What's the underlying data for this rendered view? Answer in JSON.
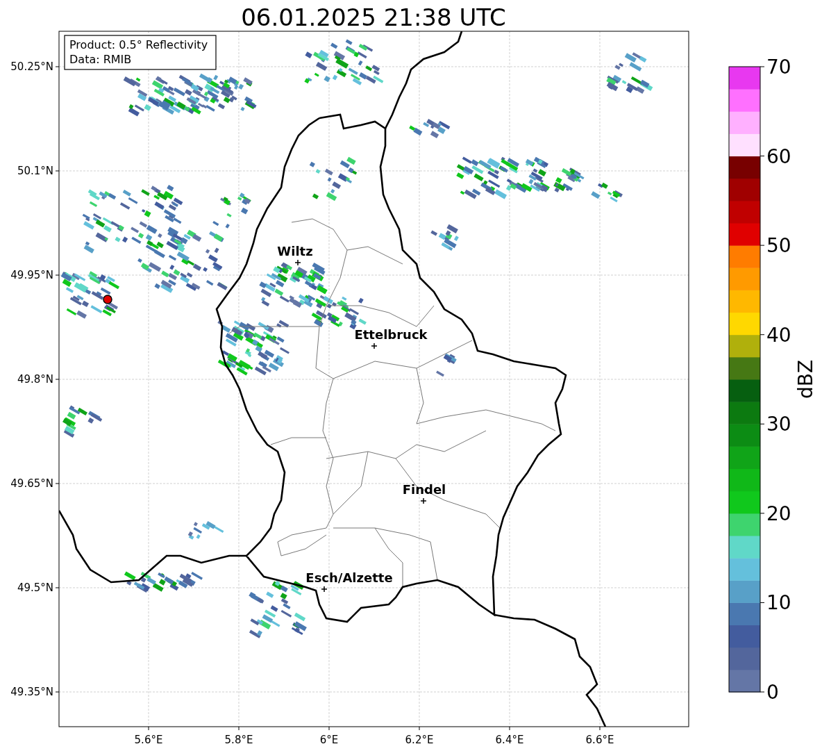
{
  "title": "06.01.2025 21:38 UTC",
  "info_box": {
    "lines": [
      "Product: 0.5° Reflectivity",
      "Data: RMIB"
    ]
  },
  "map": {
    "yticks": [
      "50.25°N",
      "50.1°N",
      "49.95°N",
      "49.8°N",
      "49.65°N",
      "49.5°N",
      "49.35°N"
    ],
    "xticks": [
      "5.6°E",
      "5.8°E",
      "6°E",
      "6.2°E",
      "6.4°E",
      "6.6°E"
    ],
    "places": [
      {
        "name": "Wiltz"
      },
      {
        "name": "Ettelbruck"
      },
      {
        "name": "Findel"
      },
      {
        "name": "Esch/Alzette"
      }
    ]
  },
  "colorbar": {
    "label": "dBZ",
    "ticks": [
      "70",
      "60",
      "50",
      "40",
      "30",
      "20",
      "10",
      "0"
    ],
    "bands": [
      {
        "color": "#6476a6"
      },
      {
        "color": "#53669c"
      },
      {
        "color": "#435c9e"
      },
      {
        "color": "#4a78b0"
      },
      {
        "color": "#58a0c8"
      },
      {
        "color": "#64c0dc"
      },
      {
        "color": "#60d8c8"
      },
      {
        "color": "#3ed46e"
      },
      {
        "color": "#10c81c"
      },
      {
        "color": "#10b818"
      },
      {
        "color": "#10a418"
      },
      {
        "color": "#0c8c14"
      },
      {
        "color": "#0c7a10"
      },
      {
        "color": "#065f10"
      },
      {
        "color": "#467814"
      },
      {
        "color": "#b0b00c"
      },
      {
        "color": "#ffd800"
      },
      {
        "color": "#ffb800"
      },
      {
        "color": "#ff9a00"
      },
      {
        "color": "#ff7c00"
      },
      {
        "color": "#e00000"
      },
      {
        "color": "#c00000"
      },
      {
        "color": "#a00000"
      },
      {
        "color": "#780000"
      },
      {
        "color": "#ffe0ff"
      },
      {
        "color": "#ffb0ff"
      },
      {
        "color": "#ff70ff"
      },
      {
        "color": "#e838f0"
      }
    ]
  }
}
